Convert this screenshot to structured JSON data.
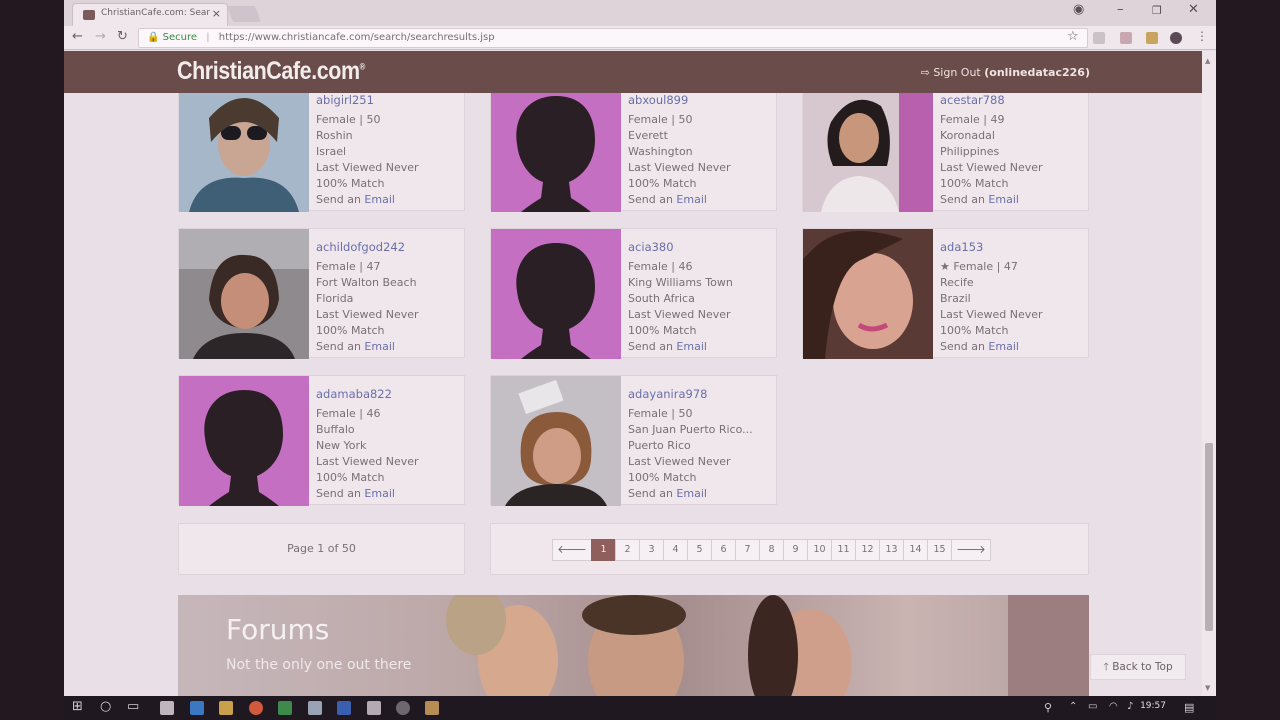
{
  "browser": {
    "tab_title": "ChristianCafe.com: Sear",
    "tab_close": "×",
    "url_secure_label": "Secure",
    "url": "https://www.christiancafe.com/search/searchresults.jsp",
    "window_controls": [
      "–",
      "❐",
      "✕"
    ]
  },
  "site": {
    "logo": "ChristianCafe.com",
    "logo_mark": "®",
    "signout_label": "Sign Out",
    "username": "(onlinedatac226)"
  },
  "profiles": [
    {
      "username": "abigirl251",
      "details": "Female | 50",
      "city": "Roshin",
      "region": "Israel",
      "viewed": "Last Viewed Never",
      "match": "100% Match",
      "photo": "photo"
    },
    {
      "username": "abxoul899",
      "details": "Female | 50",
      "city": "Everett",
      "region": "Washington",
      "viewed": "Last Viewed Never",
      "match": "100% Match",
      "photo": "silhouette"
    },
    {
      "username": "acestar788",
      "details": "Female | 49",
      "city": "Koronadal",
      "region": "Philippines",
      "viewed": "Last Viewed Never",
      "match": "100% Match",
      "photo": "photo"
    },
    {
      "username": "achildofgod242",
      "details": "Female | 47",
      "city": "Fort Walton Beach",
      "region": "Florida",
      "viewed": "Last Viewed Never",
      "match": "100% Match",
      "photo": "photo"
    },
    {
      "username": "acia380",
      "details": "Female | 46",
      "city": "King Williams Town",
      "region": "South Africa",
      "viewed": "Last Viewed Never",
      "match": "100% Match",
      "photo": "silhouette"
    },
    {
      "username": "ada153",
      "details": "★ Female | 47",
      "city": "Recife",
      "region": "Brazil",
      "viewed": "Last Viewed Never",
      "match": "100% Match",
      "photo": "photo"
    },
    {
      "username": "adamaba822",
      "details": "Female | 46",
      "city": "Buffalo",
      "region": "New York",
      "viewed": "Last Viewed Never",
      "match": "100% Match",
      "photo": "silhouette"
    },
    {
      "username": "adayanira978",
      "details": "Female | 50",
      "city": "San Juan Puerto Rico...",
      "region": "Puerto Rico",
      "viewed": "Last Viewed Never",
      "match": "100% Match",
      "photo": "photo"
    }
  ],
  "send_prefix": "Send an ",
  "send_link": "Email",
  "pagination": {
    "summary": "Page 1 of 50",
    "prev": "🡐",
    "next": "🡒",
    "pages": [
      "1",
      "2",
      "3",
      "4",
      "5",
      "6",
      "7",
      "8",
      "9",
      "10",
      "11",
      "12",
      "13",
      "14",
      "15"
    ],
    "current": "1"
  },
  "forums": {
    "title": "Forums",
    "subtitle": "Not the only one out there"
  },
  "back_to_top": "Back to Top",
  "taskbar": {
    "clock": "19:57"
  },
  "colors": {
    "header": "#6a4d4a",
    "link": "#6b6fa9",
    "silhouette_bg": "#c56fc2",
    "active_page": "#8e5f5c"
  }
}
